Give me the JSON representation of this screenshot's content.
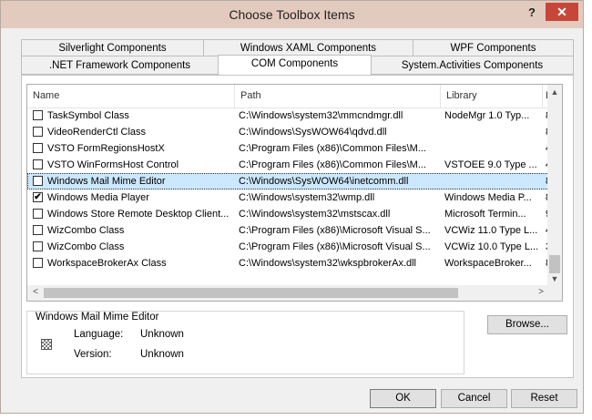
{
  "window": {
    "title": "Choose Toolbox Items",
    "help_label": "?",
    "close_label": "✕"
  },
  "tabs": {
    "row1": [
      "Silverlight Components",
      "Windows XAML Components",
      "WPF Components"
    ],
    "row2": [
      ".NET Framework Components",
      "COM Components",
      "System.Activities Components"
    ],
    "active": "COM Components"
  },
  "list": {
    "columns": [
      "Name",
      "Path",
      "Library",
      "L"
    ],
    "rows": [
      {
        "name": "TaskSymbol Class",
        "path": "C:\\Windows\\system32\\mmcndmgr.dll",
        "library": "NodeMgr 1.0 Typ...",
        "l": "8",
        "checked": false
      },
      {
        "name": "VideoRenderCtl Class",
        "path": "C:\\Windows\\SysWOW64\\qdvd.dll",
        "library": "",
        "l": "8",
        "checked": false
      },
      {
        "name": "VSTO FormRegionsHostX",
        "path": "C:\\Program Files (x86)\\Common Files\\M...",
        "library": "",
        "l": "4",
        "checked": false
      },
      {
        "name": "VSTO WinFormsHost Control",
        "path": "C:\\Program Files (x86)\\Common Files\\M...",
        "library": "VSTOEE 9.0 Type ...",
        "l": "4",
        "checked": false
      },
      {
        "name": "Windows Mail Mime Editor",
        "path": "C:\\Windows\\SysWOW64\\inetcomm.dll",
        "library": "",
        "l": "8",
        "checked": false
      },
      {
        "name": "Windows Media Player",
        "path": "C:\\Windows\\system32\\wmp.dll",
        "library": "Windows Media P...",
        "l": "8",
        "checked": true
      },
      {
        "name": "Windows Store Remote Desktop Client...",
        "path": "C:\\Windows\\system32\\mstscax.dll",
        "library": "Microsoft Termin...",
        "l": "9",
        "checked": false
      },
      {
        "name": "WizCombo Class",
        "path": "C:\\Program Files (x86)\\Microsoft Visual S...",
        "library": "VCWiz 11.0 Type L...",
        "l": "4",
        "checked": false
      },
      {
        "name": "WizCombo Class",
        "path": "C:\\Program Files (x86)\\Microsoft Visual S...",
        "library": "VCWiz 10.0 Type L...",
        "l": "3",
        "checked": false
      },
      {
        "name": "WorkspaceBrokerAx Class",
        "path": "C:\\Windows\\system32\\wkspbrokerAx.dll",
        "library": "WorkspaceBroker...",
        "l": "8",
        "checked": false
      }
    ],
    "selected_index": 4,
    "check_glyph": "✔"
  },
  "details": {
    "title": "Windows Mail Mime Editor",
    "language_label": "Language:",
    "language_value": "Unknown",
    "version_label": "Version:",
    "version_value": "Unknown"
  },
  "buttons": {
    "browse": "Browse...",
    "ok": "OK",
    "cancel": "Cancel",
    "reset": "Reset"
  },
  "scroll": {
    "up_glyph": "▲",
    "down_glyph": "▼",
    "left_glyph": "<",
    "right_glyph": ">"
  }
}
